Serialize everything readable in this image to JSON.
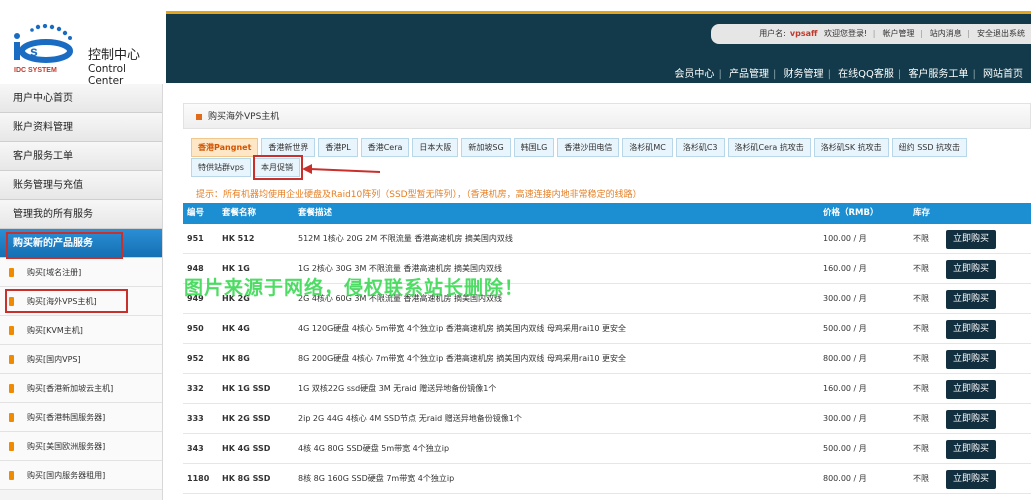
{
  "logo": {
    "title_cn": "控制中心",
    "title_en": "Control Center",
    "badge_text": "IDC SYSTEM"
  },
  "userbar": {
    "label": "用户名:",
    "username": "vpsaff",
    "welcome": "欢迎您登录!",
    "links": [
      "帐户管理",
      "站内消息",
      "安全退出系统"
    ]
  },
  "topnav": [
    "会员中心",
    "产品管理",
    "财务管理",
    "在线QQ客服",
    "客户服务工单",
    "网站首页"
  ],
  "sidebar": {
    "main_items": [
      "用户中心首页",
      "账户资料管理",
      "客户服务工单",
      "账务管理与充值",
      "管理我的所有服务"
    ],
    "active_item": "购买新的产品服务",
    "sub_items": [
      "购买[域名注册]",
      "购买[海外VPS主机]",
      "购买[KVM主机]",
      "购买[国内VPS]",
      "购买[香港新加坡云主机]",
      "购买[香港韩国服务器]",
      "购买[美国欧洲服务器]",
      "购买[国内服务器租用]"
    ]
  },
  "panel": {
    "title": "购买海外VPS主机"
  },
  "tabs_row1": [
    "香港Pangnet",
    "香港新世界",
    "香港PL",
    "香港Cera",
    "日本大阪",
    "新加坡SG",
    "韩国LG",
    "香港沙田电信",
    "洛杉矶MC",
    "洛杉矶C3",
    "洛杉矶Cera 抗攻击",
    "洛杉矶SK 抗攻击",
    "纽约 SSD 抗攻击"
  ],
  "tabs_row2": [
    "特供站群vps",
    "本月促销"
  ],
  "active_tab": "香港Pangnet",
  "tip": "提示：所有机器均使用企业硬盘及Raid10阵列（SSD型暂无阵列），（香港机房，高速连接内地非常稳定的线路）",
  "table": {
    "headers": {
      "code": "编号",
      "name": "套餐名称",
      "desc": "套餐描述",
      "price": "价格（RMB）",
      "stock": "库存"
    },
    "buy_label": "立即购买",
    "rows": [
      {
        "code": "951",
        "name": "HK 512",
        "desc": "512M 1核心 20G 2M 不限流量 香港高速机房 摘美国内双线",
        "price": "100.00 / 月",
        "stock": "不限"
      },
      {
        "code": "948",
        "name": "HK 1G",
        "desc": "1G 2核心 30G 3M 不限流量 香港高速机房 摘美国内双线",
        "price": "160.00 / 月",
        "stock": "不限"
      },
      {
        "code": "949",
        "name": "HK 2G",
        "desc": "2G 4核心 60G 3M 不限流量 香港高速机房 摘美国内双线",
        "price": "300.00 / 月",
        "stock": "不限"
      },
      {
        "code": "950",
        "name": "HK 4G",
        "desc": "4G 120G硬盘 4核心 5m带宽 4个独立ip 香港高速机房 摘美国内双线 母鸡采用rai10 更安全",
        "price": "500.00 / 月",
        "stock": "不限"
      },
      {
        "code": "952",
        "name": "HK 8G",
        "desc": "8G 200G硬盘 4核心 7m带宽 4个独立ip 香港高速机房 摘美国内双线 母鸡采用rai10 更安全",
        "price": "800.00 / 月",
        "stock": "不限"
      },
      {
        "code": "332",
        "name": "HK 1G SSD",
        "desc": "1G 双核22G ssd硬盘 3M 无raid 赠送异地备份镜像1个",
        "price": "160.00 / 月",
        "stock": "不限"
      },
      {
        "code": "333",
        "name": "HK 2G SSD",
        "desc": "2ip 2G 44G 4核心 4M SSD节点 无raid 赠送异地备份镜像1个",
        "price": "300.00 / 月",
        "stock": "不限"
      },
      {
        "code": "343",
        "name": "HK 4G SSD",
        "desc": "4核 4G 80G SSD硬盘 5m带宽 4个独立ip",
        "price": "500.00 / 月",
        "stock": "不限"
      },
      {
        "code": "1180",
        "name": "HK 8G SSD",
        "desc": "8核 8G 160G SSD硬盘 7m带宽 4个独立ip",
        "price": "800.00 / 月",
        "stock": "不限"
      }
    ]
  },
  "watermark": "图片来源于网络，侵权联系站长删除！",
  "colors": {
    "accent": "#1c8fd3",
    "header_bg": "#133a4a",
    "gold_rule": "#e5a51a",
    "highlight_red": "#c9302c",
    "tip_orange": "#e67e22"
  }
}
